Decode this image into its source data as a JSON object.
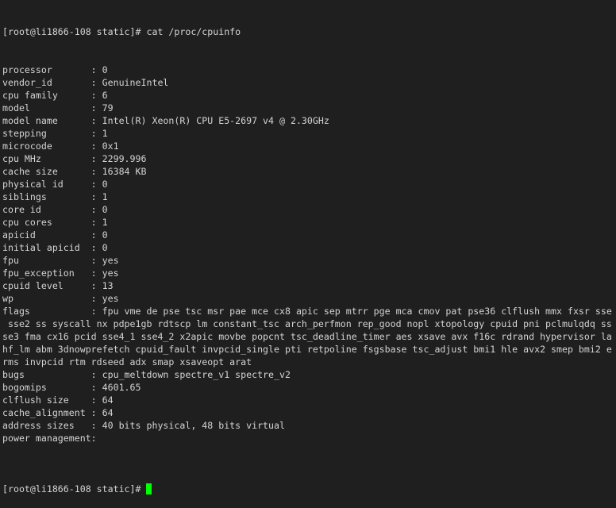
{
  "terminal": {
    "command_prompt": "[root@li1866-108 static]# ",
    "command": "cat /proc/cpuinfo",
    "output_lines": [
      "processor       : 0",
      "vendor_id       : GenuineIntel",
      "cpu family      : 6",
      "model           : 79",
      "model name      : Intel(R) Xeon(R) CPU E5-2697 v4 @ 2.30GHz",
      "stepping        : 1",
      "microcode       : 0x1",
      "cpu MHz         : 2299.996",
      "cache size      : 16384 KB",
      "physical id     : 0",
      "siblings        : 1",
      "core id         : 0",
      "cpu cores       : 1",
      "apicid          : 0",
      "initial apicid  : 0",
      "fpu             : yes",
      "fpu_exception   : yes",
      "cpuid level     : 13",
      "wp              : yes",
      "flags           : fpu vme de pse tsc msr pae mce cx8 apic sep mtrr pge mca cmov pat pse36 clflush mmx fxsr sse",
      " sse2 ss syscall nx pdpe1gb rdtscp lm constant_tsc arch_perfmon rep_good nopl xtopology cpuid pni pclmulqdq ss",
      "se3 fma cx16 pcid sse4_1 sse4_2 x2apic movbe popcnt tsc_deadline_timer aes xsave avx f16c rdrand hypervisor la",
      "hf_lm abm 3dnowprefetch cpuid_fault invpcid_single pti retpoline fsgsbase tsc_adjust bmi1 hle avx2 smep bmi2 e",
      "rms invpcid rtm rdseed adx smap xsaveopt arat",
      "bugs            : cpu_meltdown spectre_v1 spectre_v2",
      "bogomips        : 4601.65",
      "clflush size    : 64",
      "cache_alignment : 64",
      "address sizes   : 40 bits physical, 48 bits virtual",
      "power management:",
      ""
    ],
    "final_prompt": "[root@li1866-108 static]# ",
    "cursor_color": "#00ff00",
    "background_color": "#1f1f1f",
    "text_color": "#d4d4d4"
  }
}
